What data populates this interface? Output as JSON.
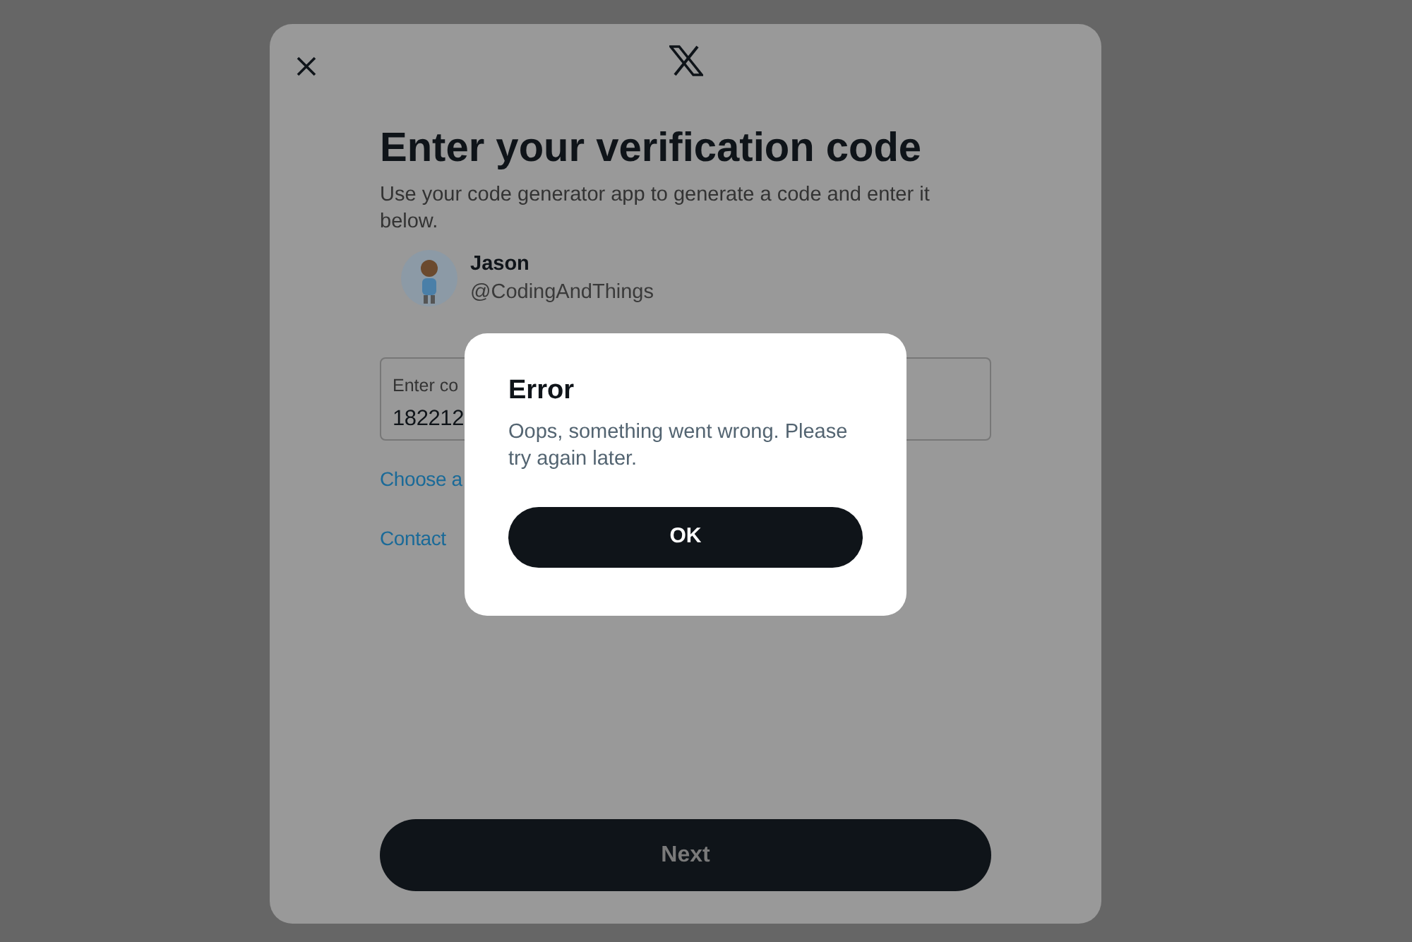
{
  "page": {
    "title": "Enter your verification code",
    "subtitle": "Use your code generator app to generate a code and enter it below."
  },
  "account": {
    "name": "Jason",
    "handle": "@CodingAndThings"
  },
  "code_field": {
    "label": "Enter co",
    "value": "182212"
  },
  "links": [
    "Choose a",
    "Contact"
  ],
  "next_button": "Next",
  "dialog": {
    "title": "Error",
    "message": "Oops, something went wrong. Please try again later.",
    "button": "OK"
  }
}
